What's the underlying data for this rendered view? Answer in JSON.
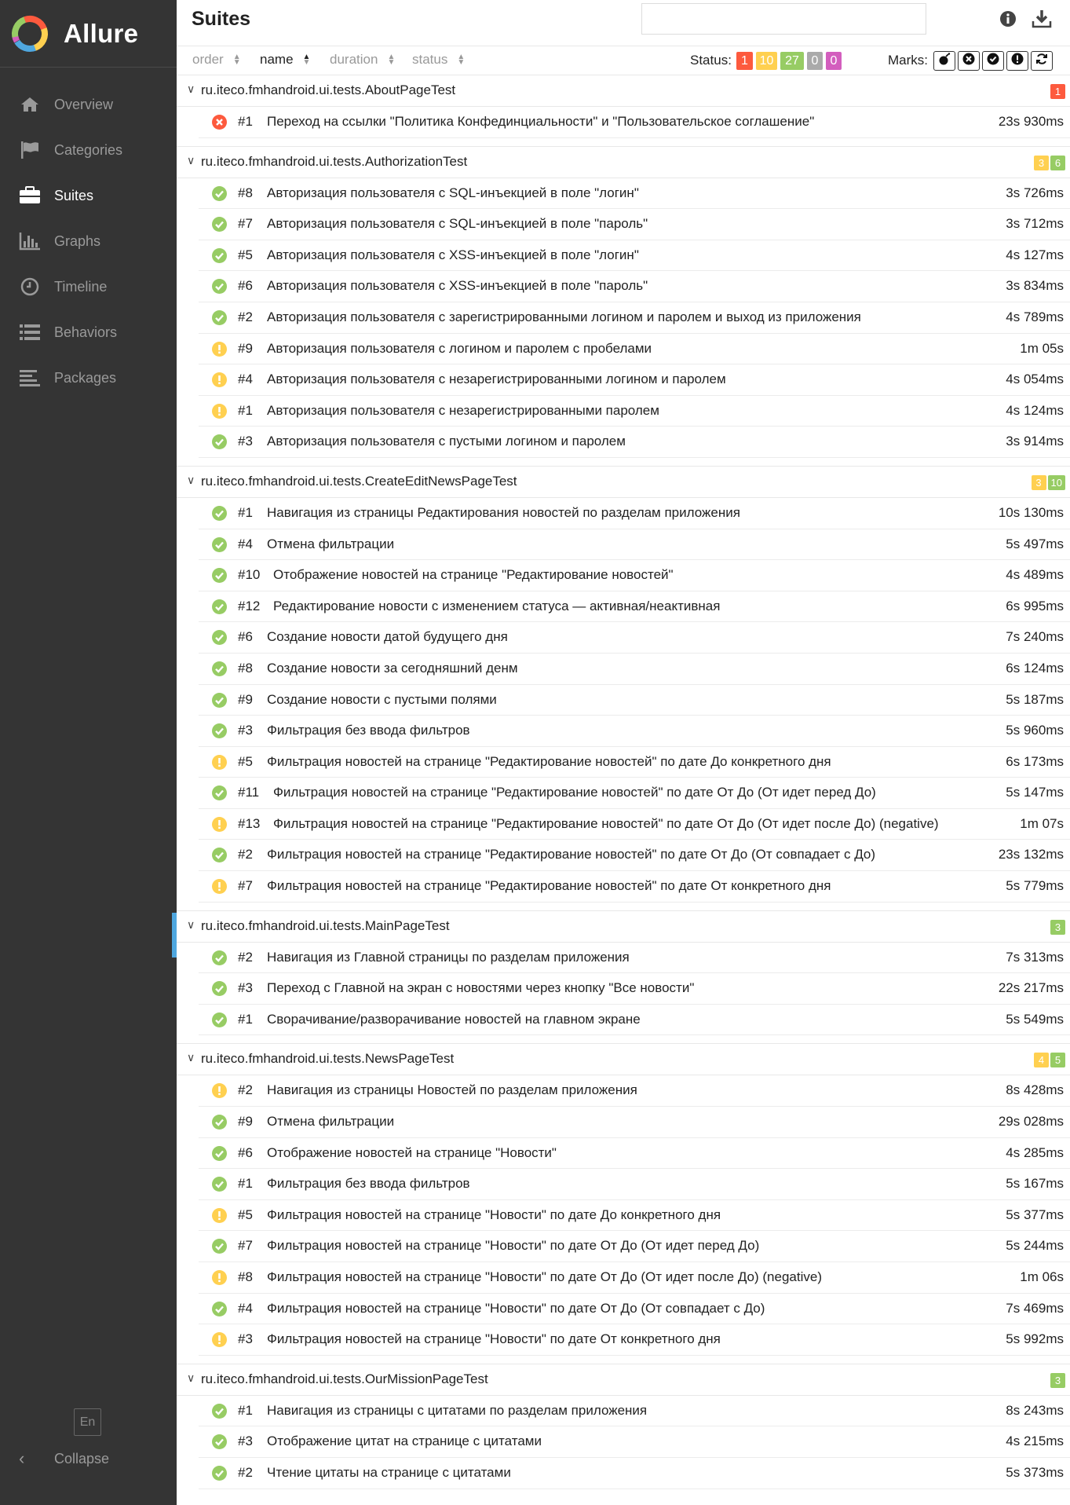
{
  "app": {
    "name": "Allure"
  },
  "nav": [
    {
      "label": "Overview",
      "icon": "home-icon"
    },
    {
      "label": "Categories",
      "icon": "flag-icon"
    },
    {
      "label": "Suites",
      "icon": "briefcase-icon",
      "active": true
    },
    {
      "label": "Graphs",
      "icon": "bar-chart-icon"
    },
    {
      "label": "Timeline",
      "icon": "clock-icon"
    },
    {
      "label": "Behaviors",
      "icon": "list-icon"
    },
    {
      "label": "Packages",
      "icon": "align-left-icon"
    }
  ],
  "footer": {
    "lang": "En",
    "collapse": "Collapse"
  },
  "header": {
    "title": "Suites",
    "search_placeholder": ""
  },
  "sort": {
    "order": "order",
    "name": "name",
    "duration": "duration",
    "status": "status"
  },
  "status_filter": {
    "label": "Status:",
    "counts": [
      {
        "value": "1",
        "color": "#fd5a3e"
      },
      {
        "value": "10",
        "color": "#ffd050"
      },
      {
        "value": "27",
        "color": "#97cc64"
      },
      {
        "value": "0",
        "color": "#aaaaaa"
      },
      {
        "value": "0",
        "color": "#d35ebe"
      }
    ]
  },
  "marks": {
    "label": "Marks:",
    "items": [
      "bomb-icon",
      "times-circle-icon",
      "check-circle-icon",
      "exclamation-circle-icon",
      "refresh-icon"
    ]
  },
  "colors": {
    "failed": "#fd5a3e",
    "broken": "#ffd050",
    "passed": "#97cc64"
  },
  "suites": [
    {
      "name": "ru.iteco.fmhandroid.ui.tests.AboutPageTest",
      "badges": [
        {
          "value": "1",
          "status": "failed"
        }
      ],
      "tests": [
        {
          "num": "#1",
          "name": "Переход на ссылки \"Политика Конфединциальности\" и \"Пользовательское соглашение\"",
          "duration": "23s 930ms",
          "status": "failed"
        }
      ]
    },
    {
      "name": "ru.iteco.fmhandroid.ui.tests.AuthorizationTest",
      "badges": [
        {
          "value": "3",
          "status": "broken"
        },
        {
          "value": "6",
          "status": "passed"
        }
      ],
      "tests": [
        {
          "num": "#8",
          "name": "Авторизация пользователя с SQL-инъекцией в поле \"логин\"",
          "duration": "3s 726ms",
          "status": "passed"
        },
        {
          "num": "#7",
          "name": "Авторизация пользователя с SQL-инъекцией в поле \"пароль\"",
          "duration": "3s 712ms",
          "status": "passed"
        },
        {
          "num": "#5",
          "name": "Авторизация пользователя с XSS-инъекцией в поле \"логин\"",
          "duration": "4s 127ms",
          "status": "passed"
        },
        {
          "num": "#6",
          "name": "Авторизация пользователя с XSS-инъекцией в поле \"пароль\"",
          "duration": "3s 834ms",
          "status": "passed"
        },
        {
          "num": "#2",
          "name": "Авторизация пользователя с зарегистрированными логином и паролем и выход из приложения",
          "duration": "4s 789ms",
          "status": "passed"
        },
        {
          "num": "#9",
          "name": "Авторизация пользователя с логином и паролем с пробелами",
          "duration": "1m 05s",
          "status": "broken"
        },
        {
          "num": "#4",
          "name": "Авторизация пользователя с незарегистрированными логином и паролем",
          "duration": "4s 054ms",
          "status": "broken"
        },
        {
          "num": "#1",
          "name": "Авторизация пользователя с незарегистрированными паролем",
          "duration": "4s 124ms",
          "status": "broken"
        },
        {
          "num": "#3",
          "name": "Авторизация пользователя с пустыми логином и паролем",
          "duration": "3s 914ms",
          "status": "passed"
        }
      ]
    },
    {
      "name": "ru.iteco.fmhandroid.ui.tests.CreateEditNewsPageTest",
      "badges": [
        {
          "value": "3",
          "status": "broken"
        },
        {
          "value": "10",
          "status": "passed"
        }
      ],
      "tests": [
        {
          "num": "#1",
          "name": "Навигация из страницы Редактирования новостей по разделам приложения",
          "duration": "10s 130ms",
          "status": "passed"
        },
        {
          "num": "#4",
          "name": "Отмена фильтрации",
          "duration": "5s 497ms",
          "status": "passed"
        },
        {
          "num": "#10",
          "name": "Отображение новостей на странице \"Редактирование новостей\"",
          "duration": "4s 489ms",
          "status": "passed"
        },
        {
          "num": "#12",
          "name": "Редактирование новости с изменением статуса — активная/неактивная",
          "duration": "6s 995ms",
          "status": "passed"
        },
        {
          "num": "#6",
          "name": "Создание новости датой будущего дня",
          "duration": "7s 240ms",
          "status": "passed"
        },
        {
          "num": "#8",
          "name": "Создание новости за сегодняшний денм",
          "duration": "6s 124ms",
          "status": "passed"
        },
        {
          "num": "#9",
          "name": "Создание новости с пустыми полями",
          "duration": "5s 187ms",
          "status": "passed"
        },
        {
          "num": "#3",
          "name": "Фильтрация без ввода фильтров",
          "duration": "5s 960ms",
          "status": "passed"
        },
        {
          "num": "#5",
          "name": "Фильтрация новостей на странице \"Редактирование новостей\" по дате До конкретного дня",
          "duration": "6s 173ms",
          "status": "broken"
        },
        {
          "num": "#11",
          "name": "Фильтрация новостей на странице \"Редактирование новостей\" по дате От До (От идет перед До)",
          "duration": "5s 147ms",
          "status": "passed"
        },
        {
          "num": "#13",
          "name": "Фильтрация новостей на странице \"Редактирование новостей\" по дате От До (От идет после До) (negative)",
          "duration": "1m 07s",
          "status": "broken"
        },
        {
          "num": "#2",
          "name": "Фильтрация новостей на странице \"Редактирование новостей\" по дате От До (От совпадает с До)",
          "duration": "23s 132ms",
          "status": "passed"
        },
        {
          "num": "#7",
          "name": "Фильтрация новостей на странице \"Редактирование новостей\" по дате От конкретного дня",
          "duration": "5s 779ms",
          "status": "broken"
        }
      ]
    },
    {
      "name": "ru.iteco.fmhandroid.ui.tests.MainPageTest",
      "badges": [
        {
          "value": "3",
          "status": "passed"
        }
      ],
      "tests": [
        {
          "num": "#2",
          "name": "Навигация из Главной страницы по разделам приложения",
          "duration": "7s 313ms",
          "status": "passed"
        },
        {
          "num": "#3",
          "name": "Переход с Главной на экран с новостями через кнопку \"Все новости\"",
          "duration": "22s 217ms",
          "status": "passed"
        },
        {
          "num": "#1",
          "name": "Сворачивание/разворачивание новостей на главном экране",
          "duration": "5s 549ms",
          "status": "passed"
        }
      ]
    },
    {
      "name": "ru.iteco.fmhandroid.ui.tests.NewsPageTest",
      "badges": [
        {
          "value": "4",
          "status": "broken"
        },
        {
          "value": "5",
          "status": "passed"
        }
      ],
      "tests": [
        {
          "num": "#2",
          "name": "Навигация из страницы Новостей по разделам приложения",
          "duration": "8s 428ms",
          "status": "broken"
        },
        {
          "num": "#9",
          "name": "Отмена фильтрации",
          "duration": "29s 028ms",
          "status": "passed"
        },
        {
          "num": "#6",
          "name": "Отображение новостей на странице \"Новости\"",
          "duration": "4s 285ms",
          "status": "passed"
        },
        {
          "num": "#1",
          "name": "Фильтрация без ввода фильтров",
          "duration": "5s 167ms",
          "status": "passed"
        },
        {
          "num": "#5",
          "name": "Фильтрация новостей на странице \"Новости\" по дате До конкретного дня",
          "duration": "5s 377ms",
          "status": "broken"
        },
        {
          "num": "#7",
          "name": "Фильтрация новостей на странице \"Новости\" по дате От До (От идет перед До)",
          "duration": "5s 244ms",
          "status": "passed"
        },
        {
          "num": "#8",
          "name": "Фильтрация новостей на странице \"Новости\" по дате От До (От идет после До) (negative)",
          "duration": "1m 06s",
          "status": "broken"
        },
        {
          "num": "#4",
          "name": "Фильтрация новостей на странице \"Новости\" по дате От До (От совпадает с До)",
          "duration": "7s 469ms",
          "status": "passed"
        },
        {
          "num": "#3",
          "name": "Фильтрация новостей на странице \"Новости\" по дате От конкретного дня",
          "duration": "5s 992ms",
          "status": "broken"
        }
      ]
    },
    {
      "name": "ru.iteco.fmhandroid.ui.tests.OurMissionPageTest",
      "badges": [
        {
          "value": "3",
          "status": "passed"
        }
      ],
      "tests": [
        {
          "num": "#1",
          "name": "Навигация из страницы с цитатами по разделам приложения",
          "duration": "8s 243ms",
          "status": "passed"
        },
        {
          "num": "#3",
          "name": "Отображение цитат на странице с цитатами",
          "duration": "4s 215ms",
          "status": "passed"
        },
        {
          "num": "#2",
          "name": "Чтение цитаты на странице с цитатами",
          "duration": "5s 373ms",
          "status": "passed"
        }
      ]
    }
  ]
}
